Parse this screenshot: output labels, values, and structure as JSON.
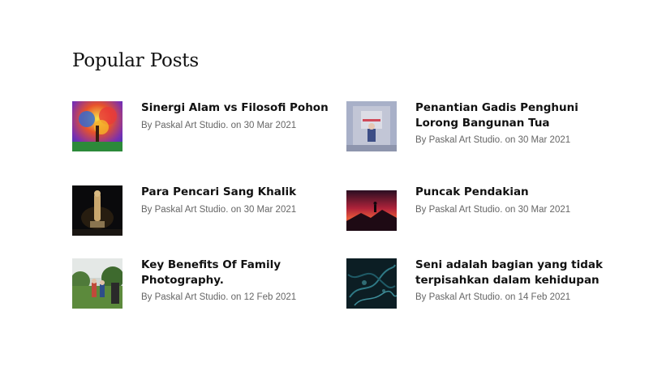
{
  "section": {
    "title": "Popular Posts"
  },
  "posts": [
    {
      "title": "Sinergi Alam vs Filosofi Pohon",
      "byline": "By Paskal Art Studio. on 30 Mar 2021",
      "thumbnail": "painting-colorful-tree"
    },
    {
      "title": "Penantian Gadis Penghuni Lorong Bangunan Tua",
      "byline": "By Paskal Art Studio. on 30 Mar 2021",
      "thumbnail": "girl-in-corridor"
    },
    {
      "title": "Para Pencari Sang Khalik",
      "byline": "By Paskal Art Studio. on 30 Mar 2021",
      "thumbnail": "statue-at-night"
    },
    {
      "title": "Puncak Pendakian",
      "byline": "By Paskal Art Studio. on 30 Mar 2021",
      "thumbnail": "hiker-silhouette-red-sky"
    },
    {
      "title": "Key Benefits Of Family Photography.",
      "byline": "By Paskal Art Studio. on 12 Feb 2021",
      "thumbnail": "family-outdoors"
    },
    {
      "title": "Seni adalah bagian yang tidak terpisahkan dalam kehidupan",
      "byline": "By Paskal Art Studio. on 14 Feb 2021",
      "thumbnail": "dark-teal-abstract"
    }
  ]
}
